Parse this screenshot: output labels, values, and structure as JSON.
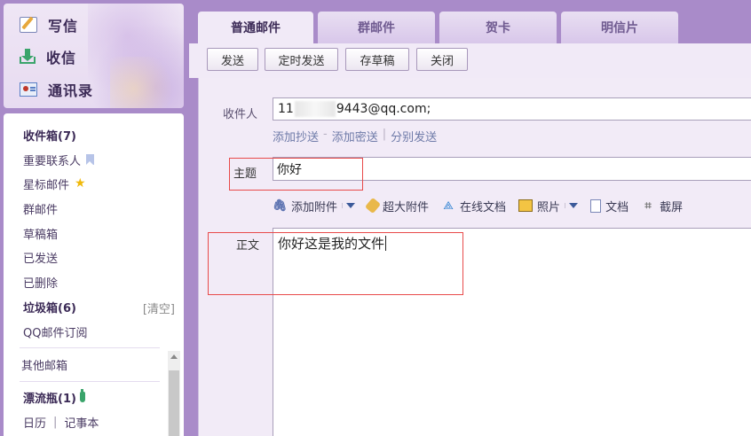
{
  "quick": {
    "write": "写信",
    "receive": "收信",
    "contacts": "通讯录"
  },
  "folders": {
    "inbox": "收件箱(7)",
    "important": "重要联系人",
    "starred": "星标邮件",
    "group": "群邮件",
    "drafts": "草稿箱",
    "sent": "已发送",
    "deleted": "已删除",
    "spam": "垃圾箱(6)",
    "spam_clear": "[清空]",
    "subscriptions": "QQ邮件订阅",
    "other": "其他邮箱",
    "bottle": "漂流瓶(1)",
    "calendar": "日历",
    "calendar_sep": "|",
    "notepad": "记事本"
  },
  "tabs": [
    "普通邮件",
    "群邮件",
    "贺卡",
    "明信片"
  ],
  "toolbar": {
    "send": "发送",
    "timed_send": "定时发送",
    "save_draft": "存草稿",
    "close": "关闭"
  },
  "compose": {
    "to_label": "收件人",
    "to_prefix": "11",
    "to_suffix": "9443@qq.com;",
    "add_cc": "添加抄送",
    "dash": "-",
    "add_bcc": "添加密送",
    "pipe": "|",
    "separate_send": "分别发送",
    "subject_label": "主题",
    "subject_value": "你好",
    "body_label": "正文",
    "body_value": "你好这是我的文件"
  },
  "editor_tools": {
    "add_attachment": "添加附件",
    "big_attachment": "超大附件",
    "online_doc": "在线文档",
    "photo": "照片",
    "document": "文档",
    "screenshot": "截屏"
  }
}
